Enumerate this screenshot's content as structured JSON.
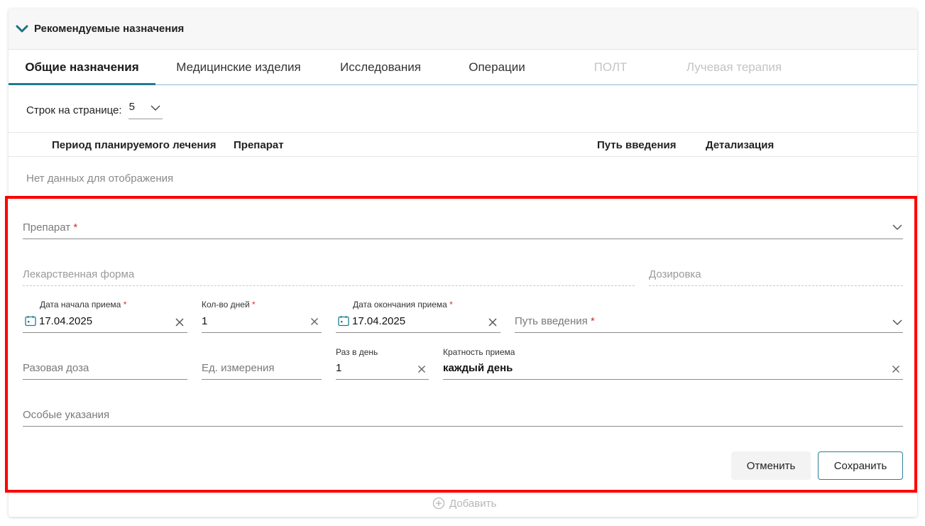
{
  "section": {
    "title": "Рекомендуемые назначения"
  },
  "tabs": [
    {
      "label": "Общие назначения",
      "state": "active"
    },
    {
      "label": "Медицинские изделия",
      "state": "normal"
    },
    {
      "label": "Исследования",
      "state": "normal"
    },
    {
      "label": "Операции",
      "state": "normal"
    },
    {
      "label": "ПОЛТ",
      "state": "disabled"
    },
    {
      "label": "Лучевая терапия",
      "state": "disabled"
    }
  ],
  "pagination": {
    "label": "Строк на странице:",
    "value": "5"
  },
  "table": {
    "columns": [
      "Период планируемого лечения",
      "Препарат",
      "Путь введения",
      "Детализация"
    ],
    "empty_text": "Нет данных для отображения"
  },
  "form": {
    "drug": {
      "label": "Препарат",
      "required_mark": "*"
    },
    "dosage_form": {
      "label": "Лекарственная форма"
    },
    "dosage": {
      "label": "Дозировка"
    },
    "start_date": {
      "label": "Дата начала приема",
      "required_mark": "*",
      "value": "17.04.2025"
    },
    "days": {
      "label": "Кол-во дней",
      "required_mark": "*",
      "value": "1"
    },
    "end_date": {
      "label": "Дата окончания приема",
      "required_mark": "*",
      "value": "17.04.2025"
    },
    "route": {
      "label": "Путь введения",
      "required_mark": "*"
    },
    "single_dose": {
      "label": "Разовая доза"
    },
    "unit": {
      "label": "Ед. измерения"
    },
    "times_per_day": {
      "label": "Раз в день",
      "value": "1"
    },
    "frequency": {
      "label": "Кратность приема",
      "value": "каждый день"
    },
    "notes": {
      "label": "Особые указания"
    }
  },
  "buttons": {
    "cancel": "Отменить",
    "save": "Сохранить",
    "add": "Добавить"
  },
  "colors": {
    "accent": "#1d7c93",
    "highlight": "#ff0000",
    "required": "#d32f2f"
  }
}
